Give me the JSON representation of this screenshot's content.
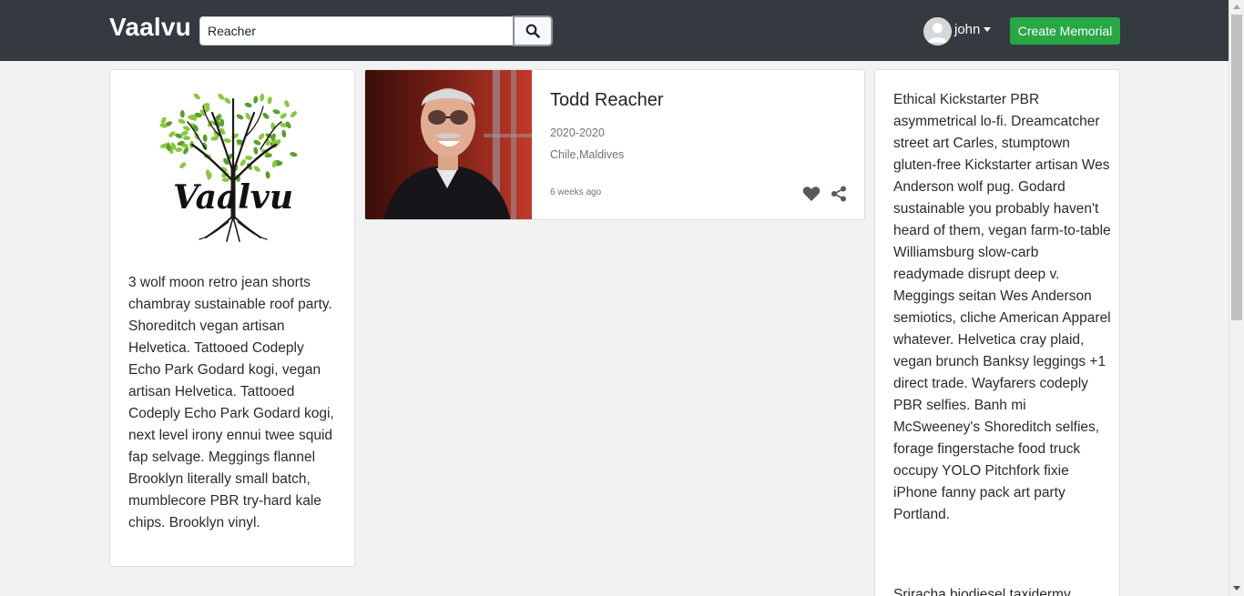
{
  "navbar": {
    "brand": "Vaalvu",
    "search": {
      "value": "Reacher",
      "button_icon": "search-icon"
    },
    "user": {
      "name": "john",
      "avatar_icon": "user-avatar-icon"
    },
    "create_button": "Create Memorial"
  },
  "left_card": {
    "logo_text": "Vaalvu",
    "description": "3 wolf moon retro jean shorts chambray sustainable roof party. Shoreditch vegan artisan Helvetica. Tattooed Codeply Echo Park Godard kogi, vegan artisan Helvetica. Tattooed Codeply Echo Park Godard kogi, next level irony ennui twee squid fap selvage. Meggings flannel Brooklyn literally small batch, mumblecore PBR try-hard kale chips. Brooklyn vinyl."
  },
  "results": [
    {
      "name": "Todd Reacher",
      "years": "2020-2020",
      "places": "Chile,Maldives",
      "posted": "6 weeks ago",
      "like_icon": "heart-icon",
      "share_icon": "share-icon"
    }
  ],
  "right_card": {
    "paragraph1": "Ethical Kickstarter PBR asymmetrical lo-fi. Dreamcatcher street art Carles, stumptown gluten-free Kickstarter artisan Wes Anderson wolf pug. Godard sustainable you probably haven't heard of them, vegan farm-to-table Williamsburg slow-carb readymade disrupt deep v. Meggings seitan Wes Anderson semiotics, cliche American Apparel whatever. Helvetica cray plaid, vegan brunch Banksy leggings +1 direct trade. Wayfarers codeply PBR selfies. Banh mi McSweeney's Shoreditch selfies, forage fingerstache food truck occupy YOLO Pitchfork fixie iPhone fanny pack art party Portland.",
    "paragraph2": "Sriracha biodiesel taxidermy"
  },
  "colors": {
    "navbar": "#343a40",
    "create_button": "#28a745",
    "page_background": "#f2f2f2",
    "logo_leaf_light": "#8dc63f",
    "logo_leaf_dark": "#5a9e2f"
  }
}
